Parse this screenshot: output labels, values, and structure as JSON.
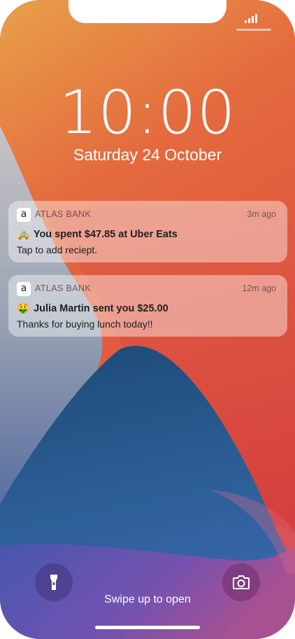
{
  "lock_screen": {
    "time": "10:00",
    "date": "Saturday 24 October"
  },
  "notifications": [
    {
      "app_icon_letter": "a",
      "app_name": "ATLAS BANK",
      "time_ago": "3m ago",
      "emoji": "🚕",
      "title": "You spent $47.85 at Uber Eats",
      "body": "Tap to add reciept."
    },
    {
      "app_icon_letter": "a",
      "app_name": "ATLAS BANK",
      "time_ago": "12m ago",
      "emoji": "🤑",
      "title": "Julia Martin sent you $25.00",
      "body": "Thanks for buying lunch today!!"
    }
  ],
  "bottom": {
    "swipe_text": "Swipe up to open",
    "left_icon": "flashlight-icon",
    "right_icon": "camera-icon"
  },
  "colors": {
    "wallpaper_orange": "#e0583f",
    "wallpaper_red": "#d63b3b",
    "wallpaper_blue": "#2e5f96",
    "wallpaper_purple": "#7b4fb0"
  }
}
